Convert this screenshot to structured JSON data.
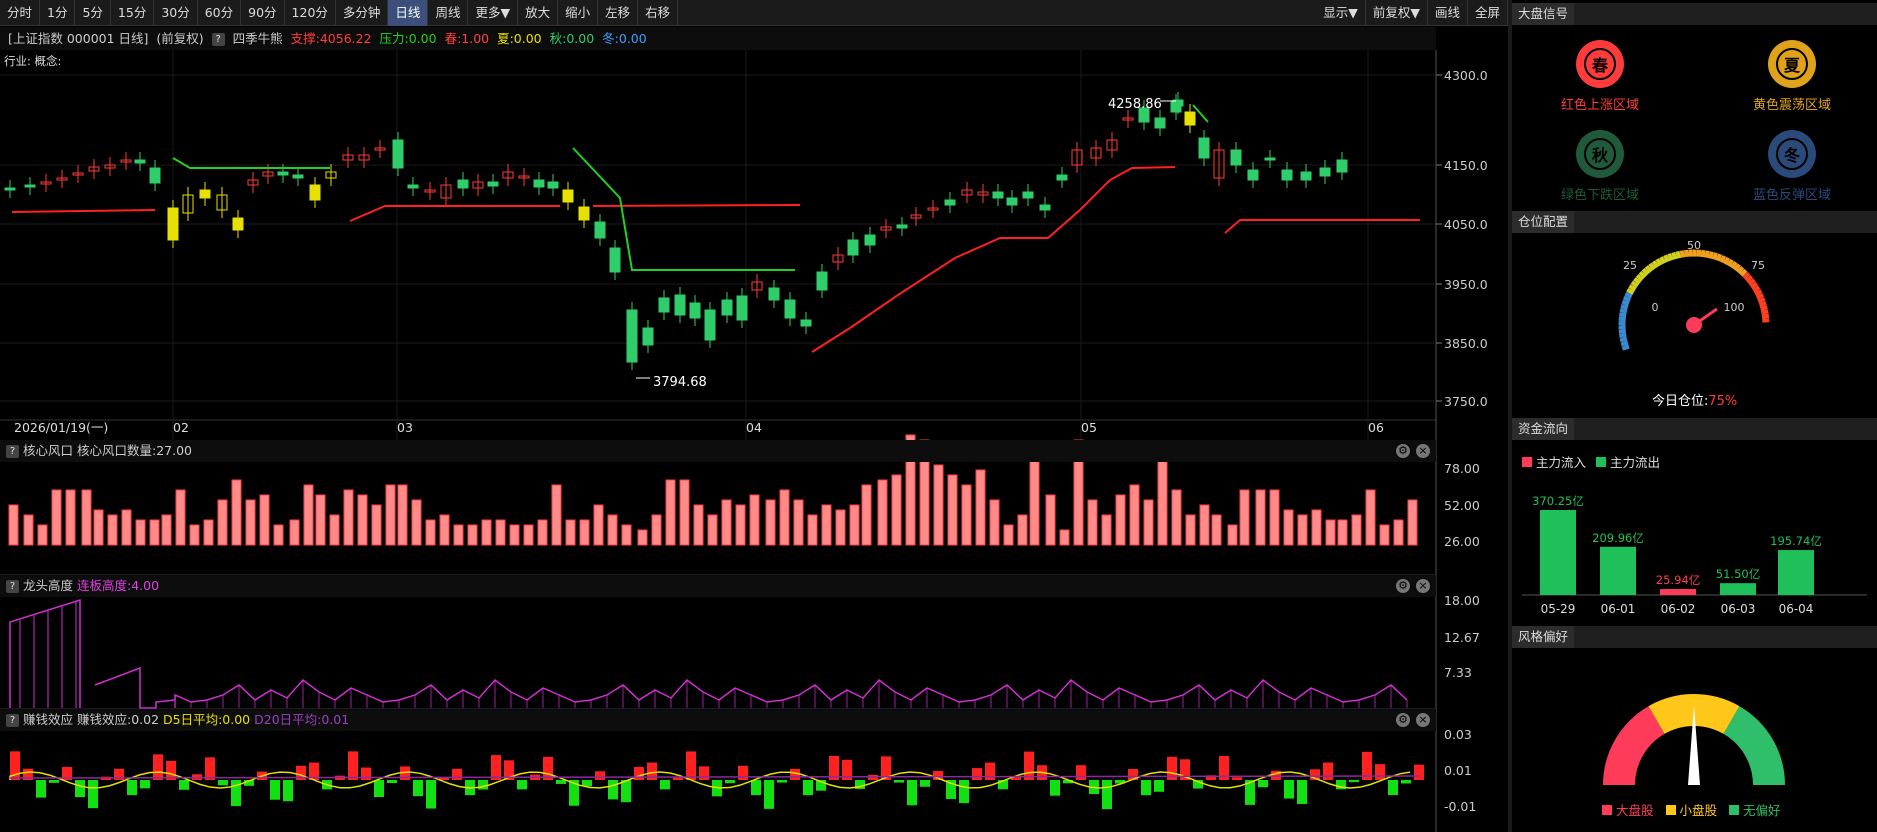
{
  "toolbar": {
    "left": [
      "分时",
      "1分",
      "5分",
      "15分",
      "30分",
      "60分",
      "90分",
      "120分",
      "多分钟",
      "日线",
      "周线",
      "更多▼",
      "放大",
      "缩小",
      "左移",
      "右移"
    ],
    "active": "日线",
    "right": [
      "显示▼",
      "前复权▼",
      "画线",
      "全屏"
    ]
  },
  "info": {
    "title": "[上证指数 000001 日线]",
    "fq": "(前复权)",
    "q": "?",
    "ind": "四季牛熊",
    "support": "支撑:4056.22",
    "pressure": "压力:0.00",
    "spring": "春:1.00",
    "summer": "夏:0.00",
    "autumn": "秋:0.00",
    "winter": "冬:0.00"
  },
  "industry": "行业: 概念:",
  "date_label": "2026/01/19(一)",
  "months": [
    "02",
    "03",
    "04",
    "05",
    "06"
  ],
  "price_axis": [
    "4300.0",
    "4150.0",
    "4050.0",
    "3950.0",
    "3850.0",
    "3750.0"
  ],
  "high_label": "4258.86",
  "low_label": "3794.68",
  "panel1": {
    "title": "核心风口",
    "value": "核心风口数量:27.00",
    "axis": [
      "78.00",
      "52.00",
      "26.00"
    ]
  },
  "panel2": {
    "title": "龙头高度",
    "value": "连板高度:4.00",
    "axis": [
      "18.00",
      "12.67",
      "7.33"
    ]
  },
  "panel3": {
    "title": "赚钱效应",
    "value": "赚钱效应:0.02",
    "d5": "D5日平均:0.00",
    "d20": "D20日平均:0.01",
    "axis": [
      "0.03",
      "0.01",
      "-0.01"
    ]
  },
  "side": {
    "s1": "大盘信号",
    "seasons": [
      {
        "ch": "春",
        "label": "红色上涨区域",
        "color": "#ff3b3b"
      },
      {
        "ch": "夏",
        "label": "黄色震荡区域",
        "color": "#e0a21a"
      },
      {
        "ch": "秋",
        "label": "绿色下跌区域",
        "color": "#1f5a3a"
      },
      {
        "ch": "冬",
        "label": "蓝色反弹区域",
        "color": "#2a4a7a"
      }
    ],
    "s2": "仓位配置",
    "gauge_ticks": [
      "0",
      "25",
      "50",
      "75",
      "100"
    ],
    "pos_label": "今日仓位:",
    "pos_value": "75%",
    "pos": 0.75,
    "s3": "资金流向",
    "legend_in": "主力流入",
    "legend_out": "主力流出",
    "flows": [
      {
        "d": "05-29",
        "v": "370.25亿",
        "n": 370.25,
        "in": false
      },
      {
        "d": "06-01",
        "v": "209.96亿",
        "n": 209.96,
        "in": false
      },
      {
        "d": "06-02",
        "v": "25.94亿",
        "n": 25.94,
        "in": true
      },
      {
        "d": "06-03",
        "v": "51.50亿",
        "n": 51.5,
        "in": false
      },
      {
        "d": "06-04",
        "v": "195.74亿",
        "n": 195.74,
        "in": false
      }
    ],
    "s4": "风格偏好",
    "style_legend": [
      "大盘股",
      "小盘股",
      "无偏好"
    ]
  }
}
